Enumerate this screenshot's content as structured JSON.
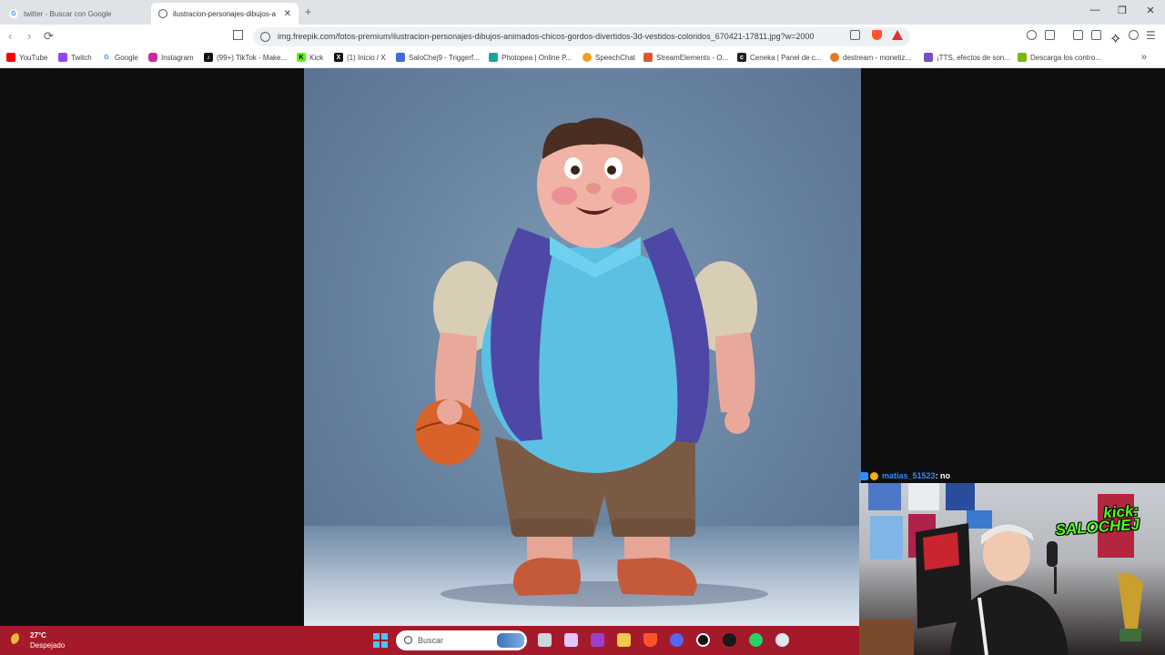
{
  "tabs": [
    {
      "label": "twitter - Buscar con Google",
      "active": false,
      "icon": "google-icon"
    },
    {
      "label": "ilustracion-personajes-dibujos-a",
      "active": true,
      "icon": "globe-icon"
    }
  ],
  "window_controls": {
    "minimize": "—",
    "restore": "❐",
    "close": "✕"
  },
  "address": {
    "url": "img.freepik.com/fotos-premium/ilustracion-personajes-dibujos-animados-chicos-gordos-divertidos-3d-vestidos-coloridos_670421-17811.jpg?w=2000"
  },
  "bookmarks": [
    {
      "label": "YouTube",
      "icon": "youtube-icon",
      "color": "#ff0000"
    },
    {
      "label": "Twitch",
      "icon": "twitch-icon",
      "color": "#9146ff"
    },
    {
      "label": "Google",
      "icon": "google-icon",
      "color": "#4285f4"
    },
    {
      "label": "Instagram",
      "icon": "instagram-icon",
      "color": "#d6249f"
    },
    {
      "label": "(99+) TikTok - Make...",
      "icon": "tiktok-icon",
      "color": "#111111"
    },
    {
      "label": "Kick",
      "icon": "kick-icon",
      "color": "#53fc18"
    },
    {
      "label": "(1) Inicio / X",
      "icon": "x-icon",
      "color": "#111111"
    },
    {
      "label": "SaloChej9 - Triggerf...",
      "icon": "triggerfyre-icon",
      "color": "#3b6fd6"
    },
    {
      "label": "Photopea | Online P...",
      "icon": "photopea-icon",
      "color": "#18a497"
    },
    {
      "label": "SpeechChat",
      "icon": "speechchat-icon",
      "color": "#f0a020"
    },
    {
      "label": "StreamElements - O...",
      "icon": "streamelements-icon",
      "color": "#e0542c"
    },
    {
      "label": "Ceneka | Panel de c...",
      "icon": "ceneka-icon",
      "color": "#222222"
    },
    {
      "label": "destream - monetiz...",
      "icon": "destream-icon",
      "color": "#e07a1f"
    },
    {
      "label": "¡TTS, efectos de son...",
      "icon": "tts-icon",
      "color": "#7a4cc2"
    },
    {
      "label": "Descarga los contro...",
      "icon": "nvidia-icon",
      "color": "#76b900"
    }
  ],
  "chat": {
    "user": "matias_51523",
    "message": ": no"
  },
  "cam_overlay": {
    "line1": "kick:",
    "line2": "SALOCHEJ"
  },
  "taskbar": {
    "weather_temp": "27°C",
    "weather_desc": "Despejado",
    "search_placeholder": "Buscar",
    "colors": {
      "bg": "#a51a2b"
    }
  }
}
